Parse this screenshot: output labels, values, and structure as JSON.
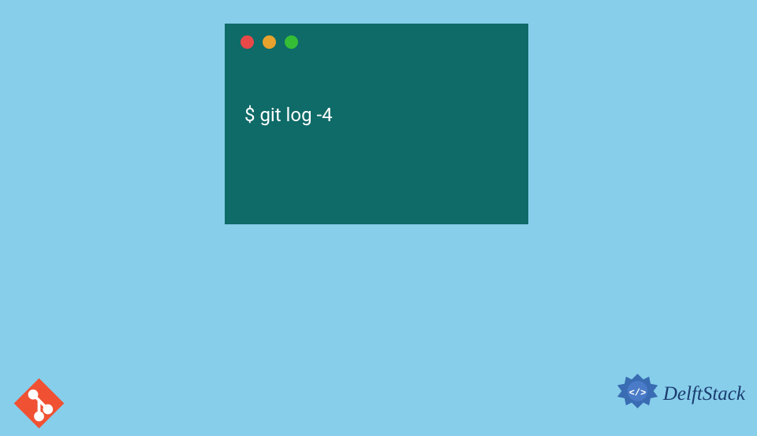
{
  "terminal": {
    "command": "$ git log -4",
    "controls": {
      "red": "close",
      "yellow": "minimize",
      "green": "maximize"
    }
  },
  "branding": {
    "site_name": "DelftStack"
  },
  "colors": {
    "background": "#87ceeb",
    "terminal_bg": "#0e6b68",
    "terminal_text": "#ffffff",
    "git_logo": "#f05133",
    "brand_text": "#1a3c6e",
    "emblem": "#2b5ba8"
  }
}
